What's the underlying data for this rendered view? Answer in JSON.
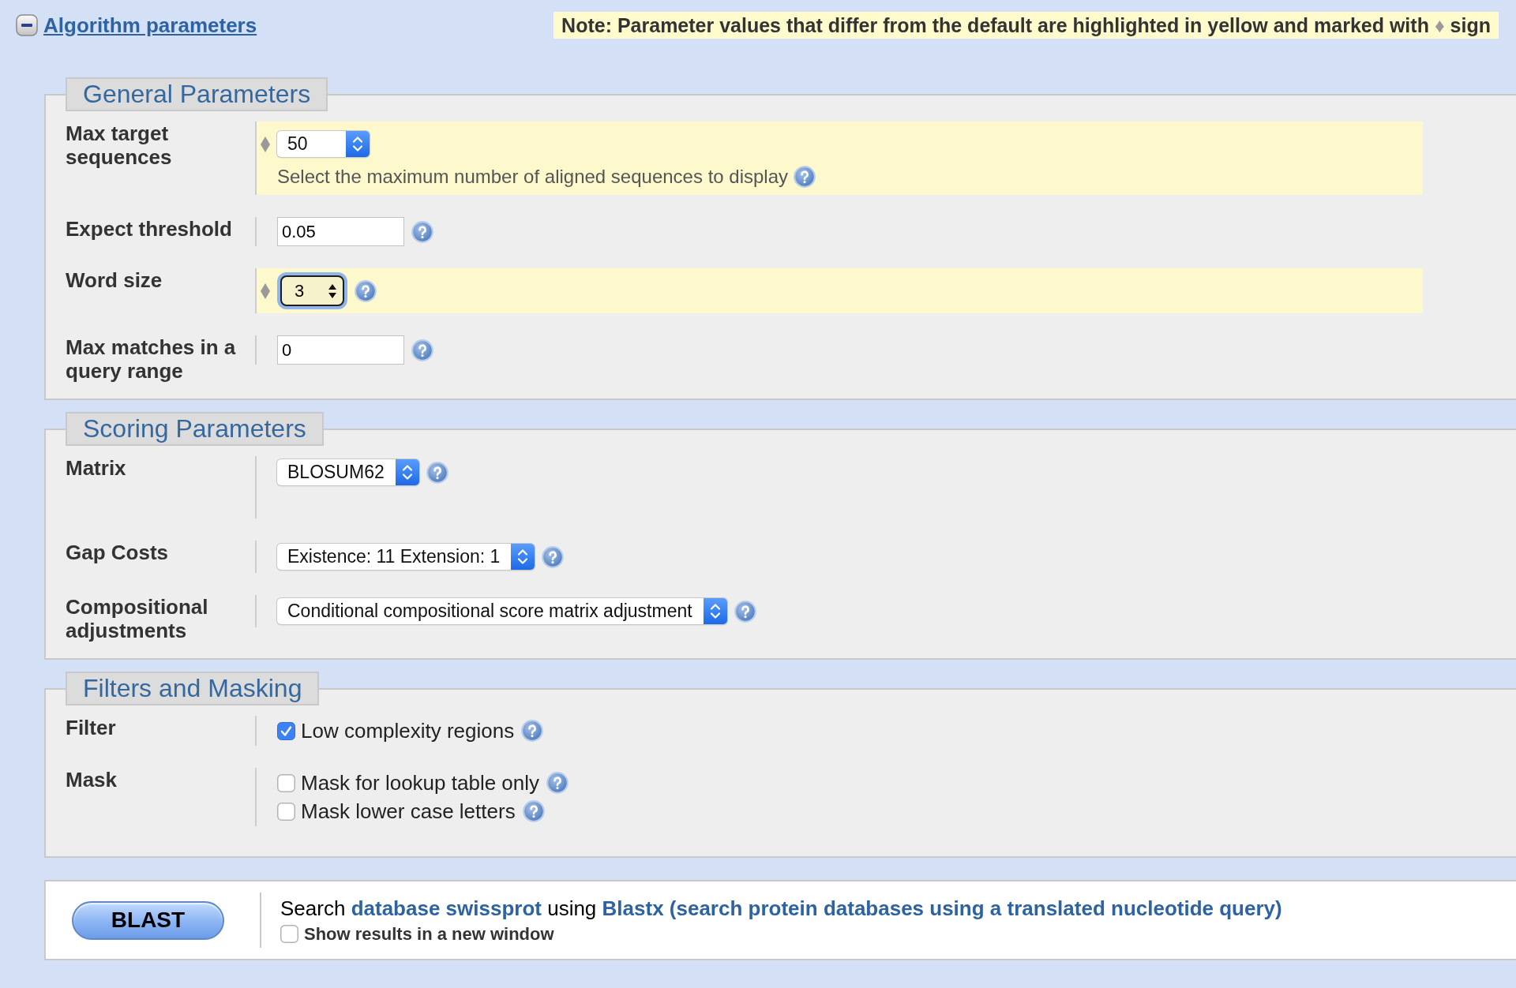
{
  "header": {
    "title": "Algorithm parameters",
    "expanded": true,
    "note": {
      "text": "Note: Parameter values that differ from the default are highlighted in yellow and marked with",
      "marker": "♦",
      "after": "sign"
    }
  },
  "sections": [
    {
      "title": "General Parameters",
      "rows": [
        {
          "label": "Max target sequences",
          "modified": true,
          "controls": [
            {
              "kind": "select",
              "value": "50",
              "focused": false,
              "help": false
            }
          ],
          "hint": {
            "text": "Select the maximum number of aligned sequences to display",
            "help": true
          }
        },
        {
          "label": "Expect threshold",
          "modified": false,
          "controls": [
            {
              "kind": "input",
              "value": "0.05",
              "help": true
            }
          ]
        },
        {
          "label": "Word size",
          "modified": true,
          "controls": [
            {
              "kind": "select",
              "value": "3",
              "focused": true,
              "help": true
            }
          ]
        },
        {
          "label": "Max matches in a query range",
          "modified": false,
          "controls": [
            {
              "kind": "input",
              "value": "0",
              "help": true
            }
          ]
        }
      ]
    },
    {
      "title": "Scoring Parameters",
      "rows": [
        {
          "label": "Matrix",
          "modified": false,
          "controls": [
            {
              "kind": "select",
              "value": "BLOSUM62",
              "focused": false,
              "help": true
            }
          ]
        },
        {
          "label": "Gap Costs",
          "modified": false,
          "controls": [
            {
              "kind": "select",
              "value": "Existence: 11 Extension: 1",
              "focused": false,
              "help": true
            }
          ]
        },
        {
          "label": "Compositional adjustments",
          "modified": false,
          "controls": [
            {
              "kind": "select",
              "value": "Conditional compositional score matrix adjustment",
              "focused": false,
              "help": true
            }
          ]
        }
      ]
    },
    {
      "title": "Filters and Masking",
      "rows": [
        {
          "label": "Filter",
          "modified": false,
          "controls": [
            {
              "kind": "checkbox",
              "label": "Low complexity regions",
              "checked": true,
              "help": true
            }
          ]
        },
        {
          "label": "Mask",
          "modified": false,
          "controls": [
            {
              "kind": "checkbox",
              "label": "Mask for lookup table only",
              "checked": false,
              "help": true
            },
            {
              "kind": "checkbox",
              "label": "Mask lower case letters",
              "checked": false,
              "help": true
            }
          ]
        }
      ]
    }
  ],
  "footer": {
    "button": "BLAST",
    "summary": [
      {
        "kind": "text",
        "text": "Search"
      },
      {
        "kind": "link",
        "text": "database swissprot"
      },
      {
        "kind": "text",
        "text": "using"
      },
      {
        "kind": "link",
        "text": "Blastx (search protein databases using a translated nucleotide query)"
      }
    ],
    "new_window": {
      "label": "Show results in a new window",
      "checked": false
    }
  }
}
